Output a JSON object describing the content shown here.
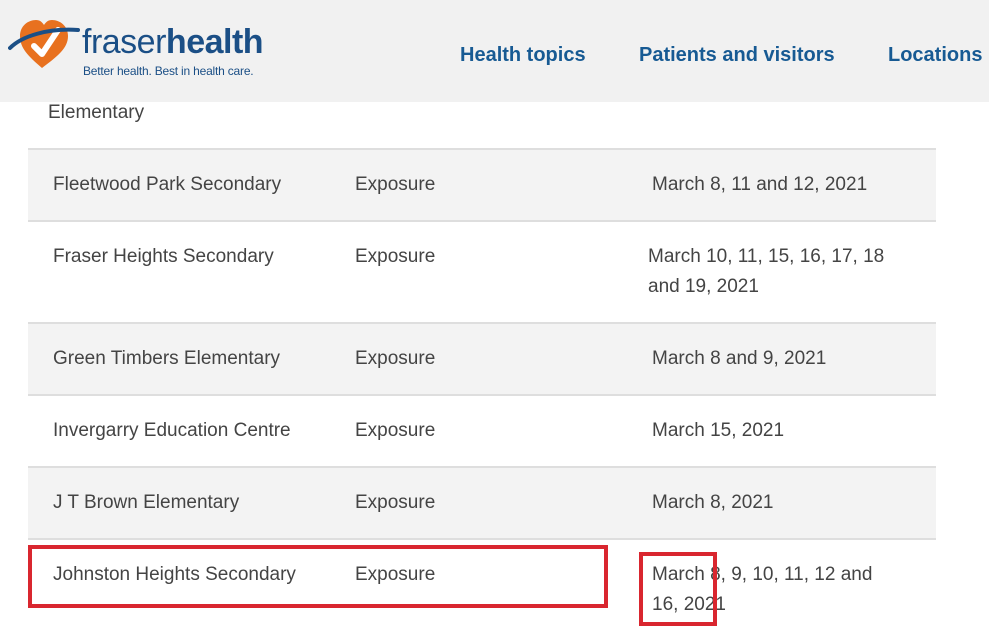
{
  "header": {
    "logo": {
      "word_light": "fraser",
      "word_bold": "health",
      "tagline": "Better health. Best in health care."
    },
    "nav": [
      {
        "label": "Health topics"
      },
      {
        "label": "Patients and visitors"
      },
      {
        "label": "Locations"
      }
    ]
  },
  "table": {
    "partial_text": "Elementary",
    "rows": [
      {
        "school": "Fleetwood Park Secondary",
        "type": "Exposure",
        "dates": "March 8, 11 and 12, 2021"
      },
      {
        "school": "Fraser Heights Secondary",
        "type": "Exposure",
        "dates": "March 10, 11, 15, 16, 17, 18 and 19, 2021"
      },
      {
        "school": "Green Timbers Elementary",
        "type": "Exposure",
        "dates": "March 8 and 9, 2021"
      },
      {
        "school": "Invergarry Education Centre",
        "type": "Exposure",
        "dates": "March 15, 2021"
      },
      {
        "school": "J T Brown Elementary",
        "type": "Exposure",
        "dates": "March 8, 2021"
      },
      {
        "school": "Johnston Heights Secondary",
        "type": "Exposure",
        "dates": "March 8, 9, 10, 11, 12 and 16, 2021"
      }
    ]
  },
  "colors": {
    "brand_blue": "#1b4f86",
    "nav_blue": "#175a93",
    "logo_orange": "#e8711f",
    "highlight_red": "#d9262f"
  }
}
